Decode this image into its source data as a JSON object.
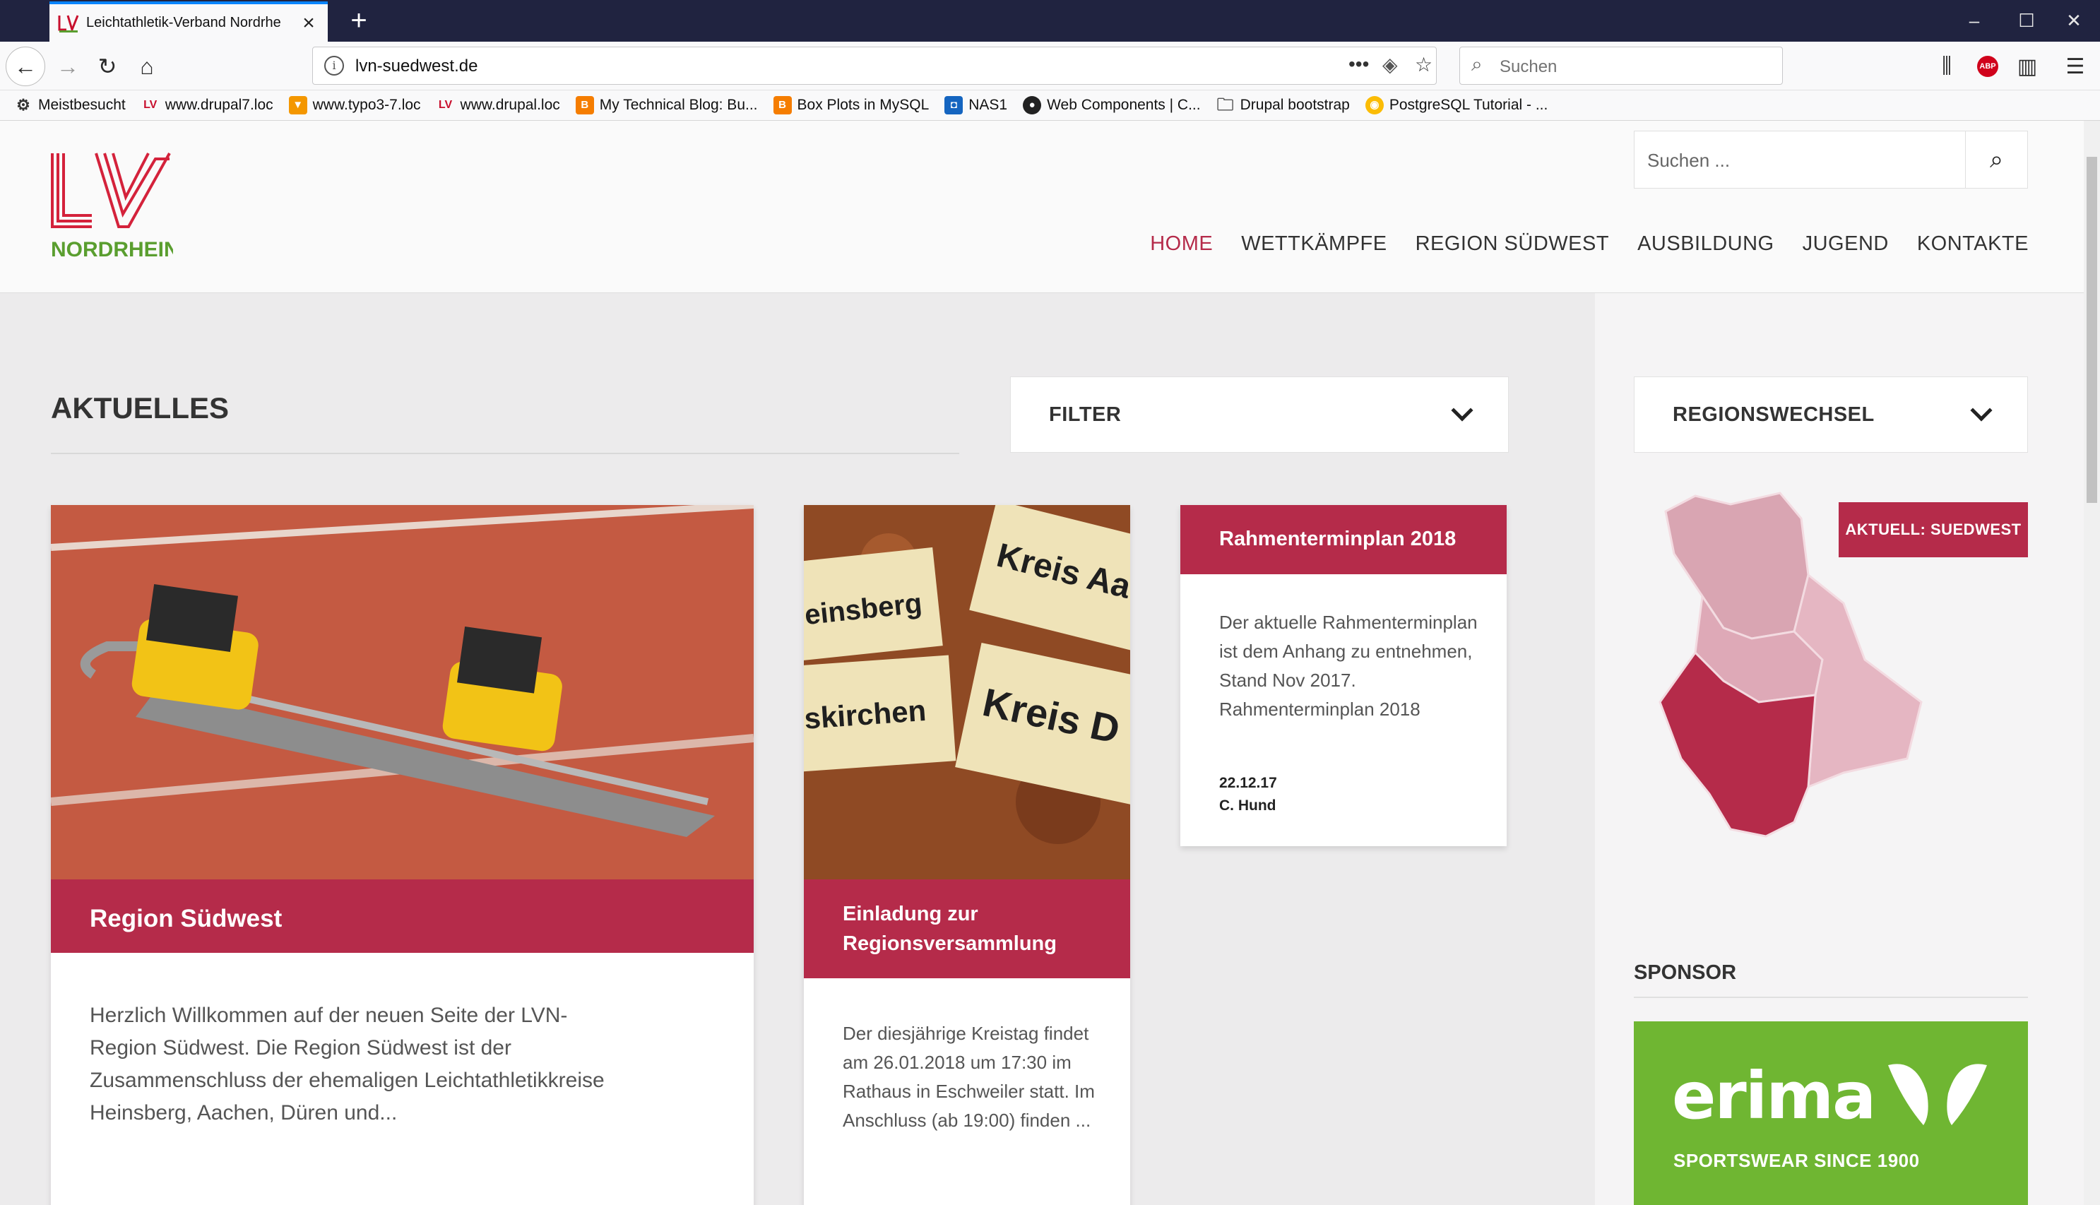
{
  "browser": {
    "tab_title": "Leichtathletik-Verband Nordrhe",
    "url": "lvn-suedwest.de",
    "search_placeholder": "Suchen",
    "bookmarks": [
      {
        "label": "Meistbesucht",
        "icon": "gear-icon"
      },
      {
        "label": "www.drupal7.loc",
        "icon": "lv-favicon"
      },
      {
        "label": "www.typo3-7.loc",
        "icon": "typo3-favicon"
      },
      {
        "label": "www.drupal.loc",
        "icon": "lv-favicon"
      },
      {
        "label": "My Technical Blog: Bu...",
        "icon": "blogger-favicon"
      },
      {
        "label": "Box Plots in MySQL",
        "icon": "blogger-favicon"
      },
      {
        "label": "NAS1",
        "icon": "nas-favicon"
      },
      {
        "label": "Web Components | C...",
        "icon": "github-favicon"
      },
      {
        "label": "Drupal bootstrap",
        "icon": "folder-icon"
      },
      {
        "label": "PostgreSQL Tutorial - ...",
        "icon": "chrome-favicon"
      }
    ]
  },
  "site": {
    "logo_text": "NORDRHEIN",
    "search_placeholder": "Suchen ...",
    "nav": [
      "HOME",
      "WETTKÄMPFE",
      "REGION SÜDWEST",
      "AUSBILDUNG",
      "JUGEND",
      "KONTAKTE"
    ],
    "active_nav": "HOME",
    "accent": "#b52b4a"
  },
  "main": {
    "heading": "AKTUELLES",
    "filter_label": "FILTER",
    "cards": [
      {
        "title": "Region Südwest",
        "text": "Herzlich Willkommen auf der neuen Seite der LVN-Region Südwest. Die Region Südwest ist der Zusammenschluss der ehemaligen Leichtathletikkreise Heinsberg, Aachen, Düren und..."
      },
      {
        "title": "Einladung zur Regionsversammlung",
        "text": "Der diesjährige Kreistag findet am 26.01.2018 um 17:30 im Rathaus in Eschweiler statt. Im Anschluss (ab 19:00) finden ...",
        "image_signs": [
          "einsberg",
          "Kreis Aa",
          "skirchen",
          "Kreis D"
        ]
      },
      {
        "title": "Rahmenterminplan 2018",
        "text": "Der aktuelle Rahmenterminplan ist dem Anhang zu entnehmen, Stand Nov 2017. Rahmenterminplan 2018",
        "date": "22.12.17",
        "author": "C. Hund"
      }
    ]
  },
  "sidebar": {
    "region_label": "REGIONSWECHSEL",
    "current_badge": "AKTUELL: SUEDWEST",
    "sponsor_heading": "SPONSOR",
    "sponsor_name": "erima",
    "sponsor_tagline": "SPORTSWEAR SINCE 1900"
  }
}
